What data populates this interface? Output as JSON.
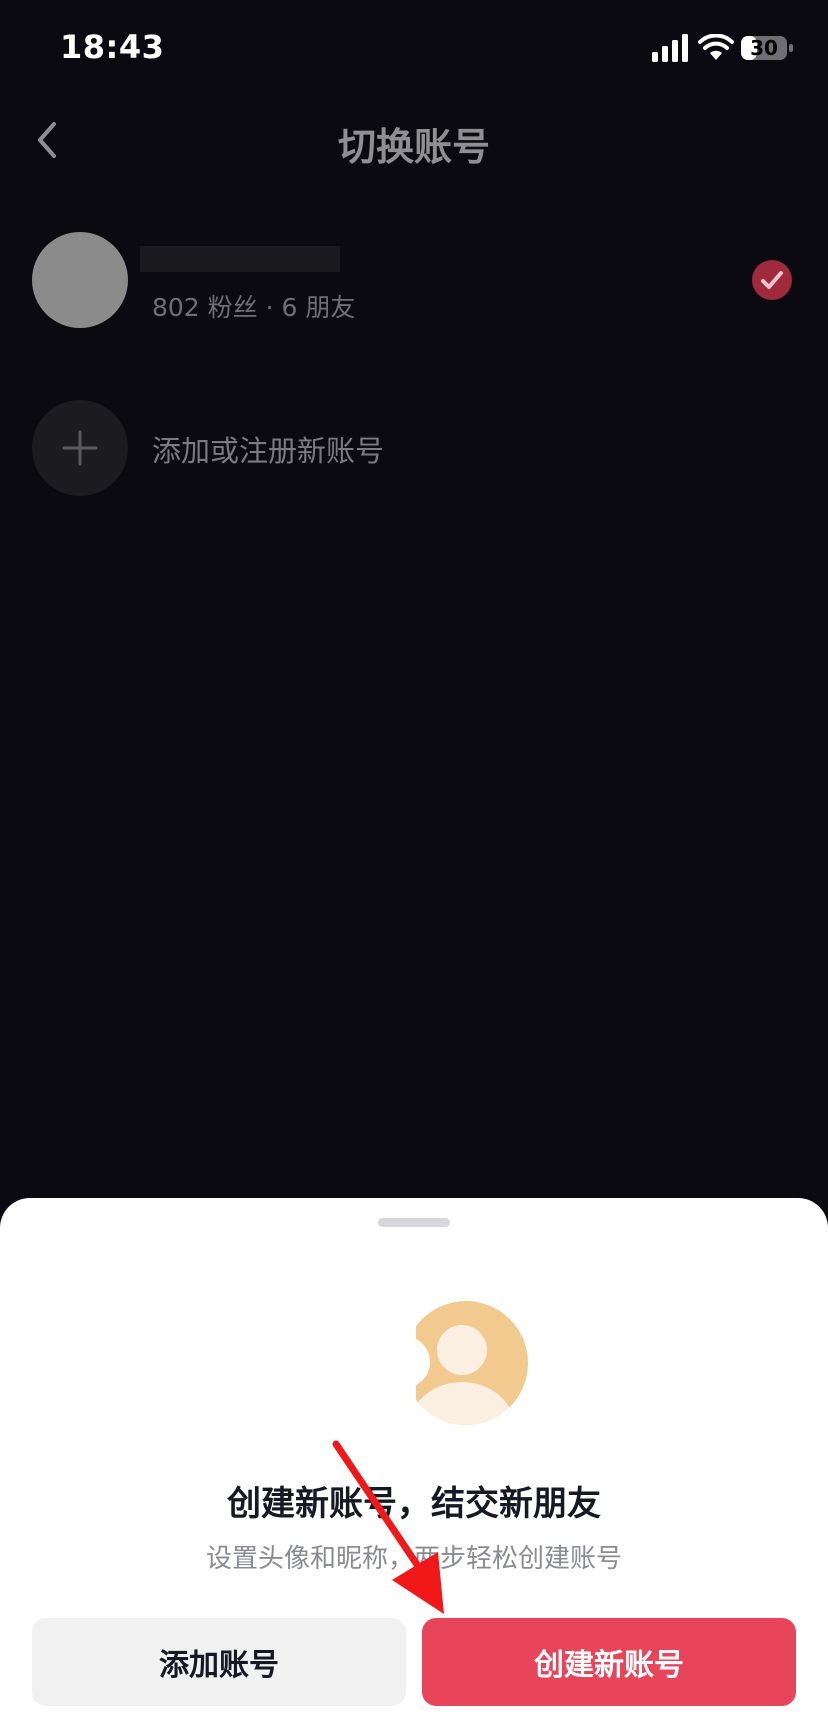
{
  "status_bar": {
    "time": "18:43",
    "battery_level": "30",
    "icons": [
      "cellular-signal-icon",
      "wifi-icon",
      "battery-icon"
    ]
  },
  "header": {
    "title": "切换账号",
    "back_icon": "chevron-left-icon"
  },
  "accounts": [
    {
      "stats": "802 粉丝 · 6 朋友",
      "selected": true
    }
  ],
  "add_account_row": {
    "label": "添加或注册新账号",
    "icon": "plus-icon"
  },
  "sheet": {
    "title": "创建新账号，结交新朋友",
    "subtitle": "设置头像和昵称，两步轻松创建账号",
    "add_button": "添加账号",
    "create_button": "创建新账号"
  },
  "colors": {
    "background": "#0b0a10",
    "accent": "#e8445a",
    "check_badge": "#9e2a3b",
    "illustration": "#f2c98e"
  }
}
